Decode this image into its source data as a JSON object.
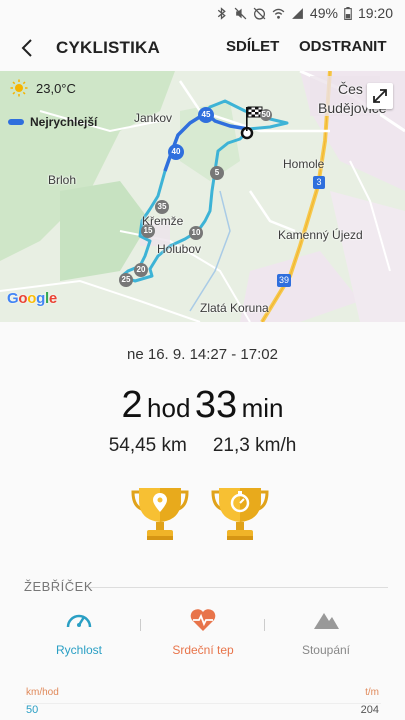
{
  "status_bar": {
    "battery": "49%",
    "time": "19:20"
  },
  "app_bar": {
    "title": "CYKLISTIKA",
    "share_label": "SDÍLET",
    "remove_label": "ODSTRANIT"
  },
  "map": {
    "temperature": "23,0°C",
    "legend_label": "Nejrychlejší",
    "places": {
      "ceske_budejovice_1": "Čes",
      "ceske_budejovice_2": "Budějovice",
      "jankov": "Jankov",
      "brloh": "Brloh",
      "homole": "Homole",
      "kremze": "Křemže",
      "holubov": "Holubov",
      "kamenny_ujezd": "Kamenný Újezd",
      "zlata_koruna": "Zlatá Koruna"
    },
    "road_numbers": {
      "r3": "3",
      "r39": "39"
    },
    "km_markers": {
      "m5": "5",
      "m10": "10",
      "m15": "15",
      "m20": "20",
      "m25": "25",
      "m35": "35",
      "m40": "40",
      "m45": "45",
      "m50": "50"
    },
    "attribution": "Google"
  },
  "summary": {
    "date": "ne 16. 9. 14:27 - 17:02",
    "hours": "2",
    "hours_unit": "hod",
    "minutes": "33",
    "minutes_unit": "min",
    "distance": "54,45 km",
    "speed": "21,3 km/h"
  },
  "ranking": {
    "header": "ŽEBŘÍČEK",
    "tabs": {
      "speed": "Rychlost",
      "heart_rate": "Srdeční tep",
      "elevation": "Stoupání"
    },
    "colors": {
      "speed": "#2a9fc4",
      "heart_rate": "#e8744a",
      "elevation": "#999999"
    }
  },
  "chart": {
    "left_unit": "km/hod",
    "left_value": "50",
    "right_unit": "t/m",
    "right_value": "204"
  }
}
